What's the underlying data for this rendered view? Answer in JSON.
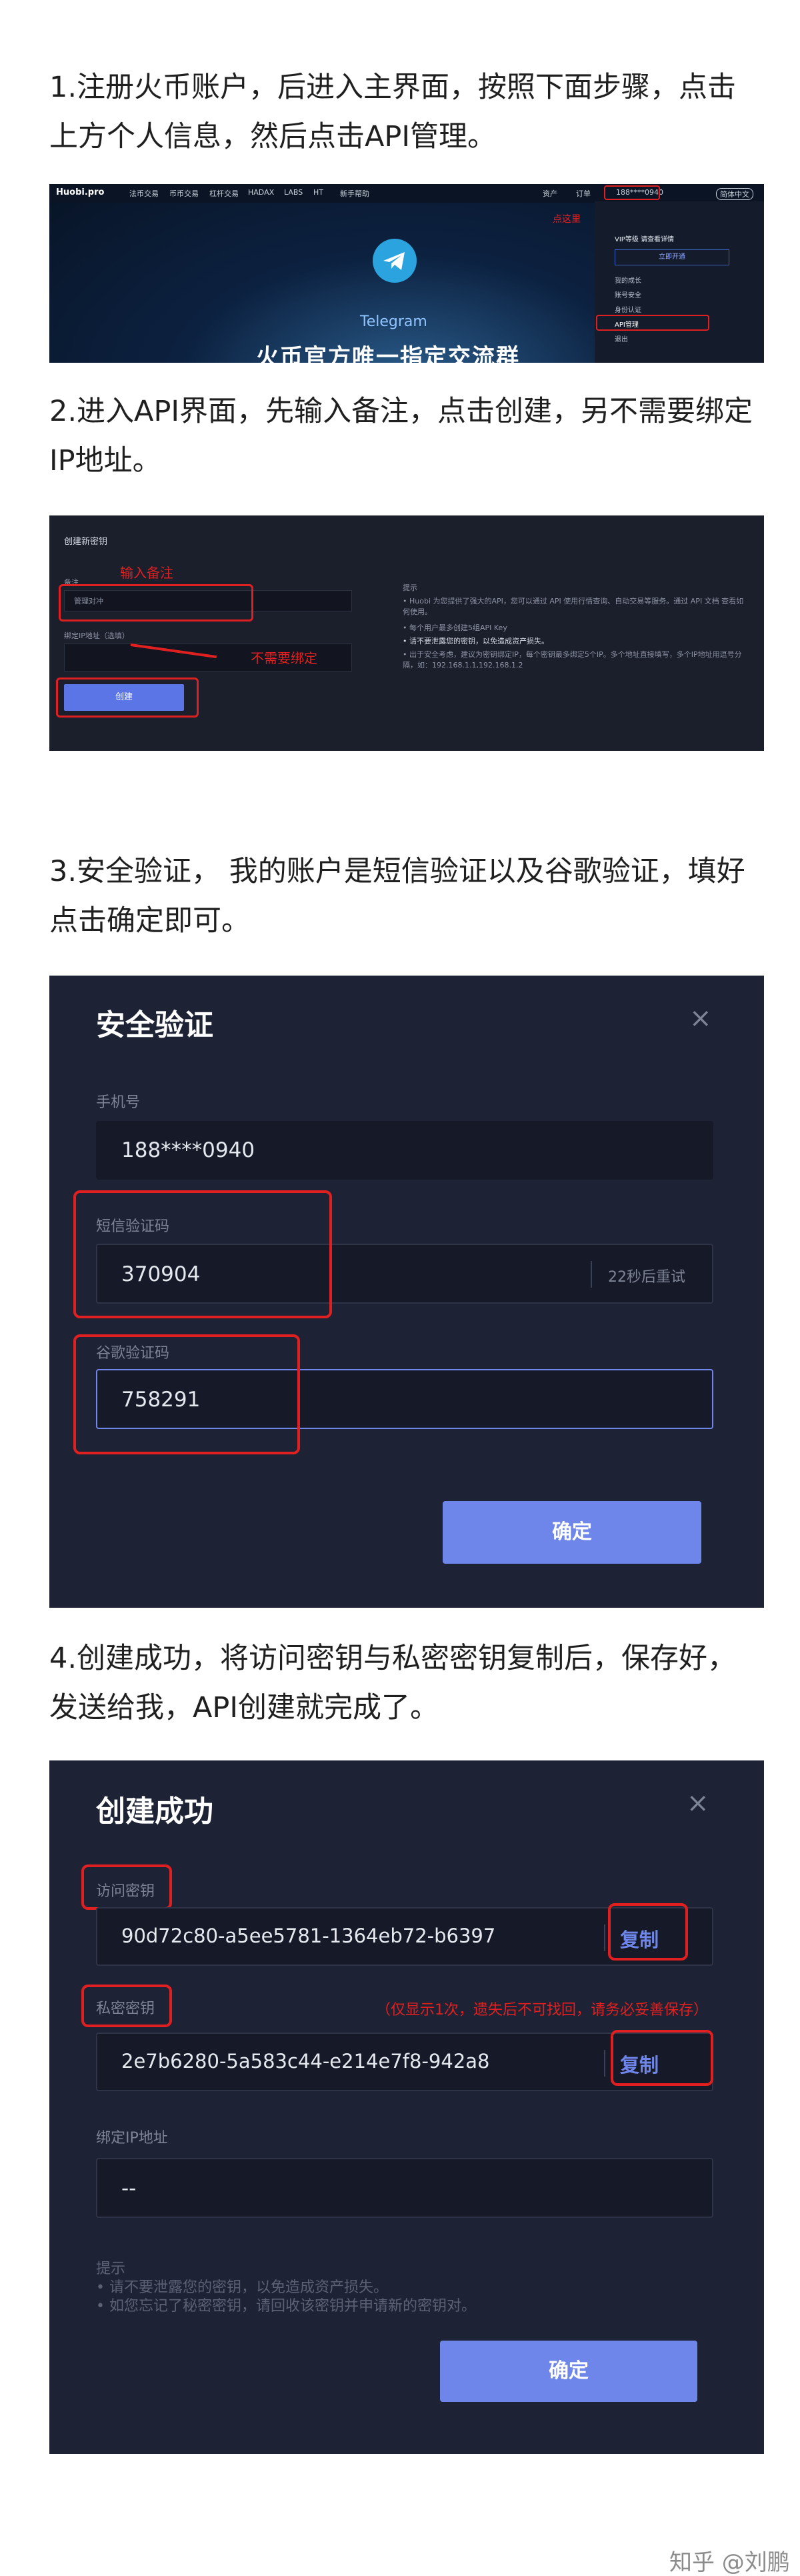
{
  "steps": {
    "s1": "1.注册火币账户，后进入主界面，按照下面步骤，点击上方个人信息，然后点击API管理。",
    "s2": "2.进入API界面，先输入备注，点击创建，另不需要绑定IP地址。",
    "s3": "3.安全验证， 我的账户是短信验证以及谷歌验证，填好点击确定即可。",
    "s4": "4.创建成功，将访问密钥与私密密钥复制后，保存好，发送给我，API创建就完成了。"
  },
  "shot1": {
    "logo": "Huobi.pro",
    "nav": [
      "法币交易",
      "币币交易",
      "杠杆交易",
      "HADAX",
      "LABS",
      "HT",
      "新手帮助"
    ],
    "right_nav": [
      "资产",
      "订单",
      "188****0940",
      "简体中文"
    ],
    "annotation": "点这里",
    "menu_header": "VIP等级 请查看详情",
    "menu_button": "立即开通",
    "menu_items": [
      "我的成长",
      "账号安全",
      "身份认证",
      "API管理",
      "退出"
    ],
    "telegram": "Telegram",
    "banner": "火币官方唯一指定交流群"
  },
  "shot2": {
    "title": "创建新密钥",
    "note_label": "备注",
    "note_annotation": "输入备注",
    "note_placeholder": "管理对冲",
    "ip_label": "绑定IP地址（选填）",
    "ip_annotation": "不需要绑定",
    "create_button": "创建",
    "hint_title": "提示",
    "hints": [
      "• Huobi 为您提供了强大的API，您可以通过 API 使用行情查询、自动交易等服务。通过 API 文档 查看如何使用。",
      "• 每个用户最多创建5组API Key",
      "• 请不要泄露您的密钥，以免造成资产损失。",
      "• 出于安全考虑，建议为密钥绑定IP，每个密钥最多绑定5个IP。多个地址直接填写，多个IP地址用逗号分隔，如：192.168.1.1,192.168.1.2"
    ]
  },
  "shot3": {
    "title": "安全验证",
    "phone_label": "手机号",
    "phone_value": "188****0940",
    "sms_label": "短信验证码",
    "sms_value": "370904",
    "sms_resend": "22秒后重试",
    "google_label": "谷歌验证码",
    "google_value": "758291",
    "confirm": "确定"
  },
  "shot4": {
    "title": "创建成功",
    "access_label": "访问密钥",
    "access_value": "90d72c80-a5ee5781-1364eb72-b6397",
    "copy1": "复制",
    "secret_label": "私密密钥",
    "secret_note": "（仅显示1次，遗失后不可找回，请务必妥善保存）",
    "secret_value": "2e7b6280-5a583c44-e214e7f8-942a8",
    "copy2": "复制",
    "ip_label": "绑定IP地址",
    "ip_value": "--",
    "tip_title": "提示",
    "tips": [
      "• 请不要泄露您的密钥，以免造成资产损失。",
      "• 如您忘记了秘密密钥，请回收该密钥并申请新的密钥对。"
    ],
    "confirm": "确定"
  },
  "watermark": "知乎 @刘鹏",
  "colors": {
    "annotation_red": "#e02020",
    "button_blue": "#6e85ea",
    "dialog_bg": "#1e2235"
  },
  "icons": [
    "telegram-icon",
    "close-icon",
    "user-icon"
  ]
}
